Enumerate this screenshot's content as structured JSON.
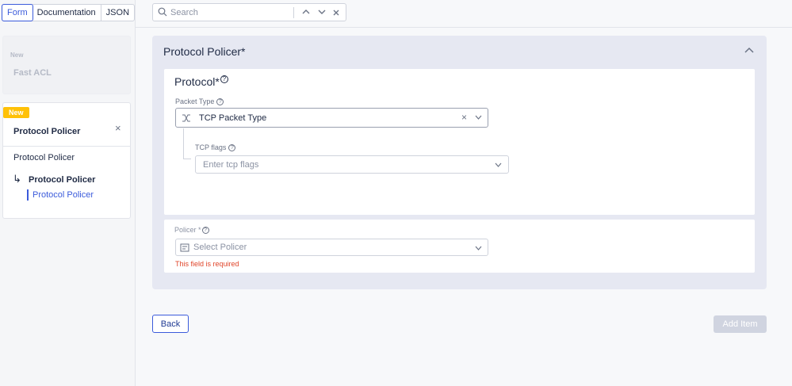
{
  "tabs": [
    {
      "label": "Form"
    },
    {
      "label": "Documentation"
    },
    {
      "label": "JSON"
    }
  ],
  "search": {
    "placeholder": "Search"
  },
  "sidebar": {
    "fast_acl": {
      "tag": "New",
      "title": "Fast ACL"
    },
    "protocol_policer": {
      "badge": "New",
      "title": "Protocol Policer",
      "close": "×",
      "items": [
        "Protocol Policer",
        "Protocol Policer",
        "Protocol Policer"
      ]
    }
  },
  "section": {
    "title": "Protocol Policer*",
    "protocol": {
      "title": "Protocol*",
      "packet_type_label": "Packet Type",
      "packet_type_value": "TCP Packet Type",
      "tcp_flags_label": "TCP flags",
      "tcp_flags_placeholder": "Enter tcp flags"
    },
    "policer": {
      "label": "Policer *",
      "placeholder": "Select Policer",
      "error": "This field is required"
    }
  },
  "buttons": {
    "back": "Back",
    "add_item": "Add Item"
  },
  "colors": {
    "accent": "#3b5bdb",
    "badge": "#ffc107",
    "error": "#e0452a"
  }
}
